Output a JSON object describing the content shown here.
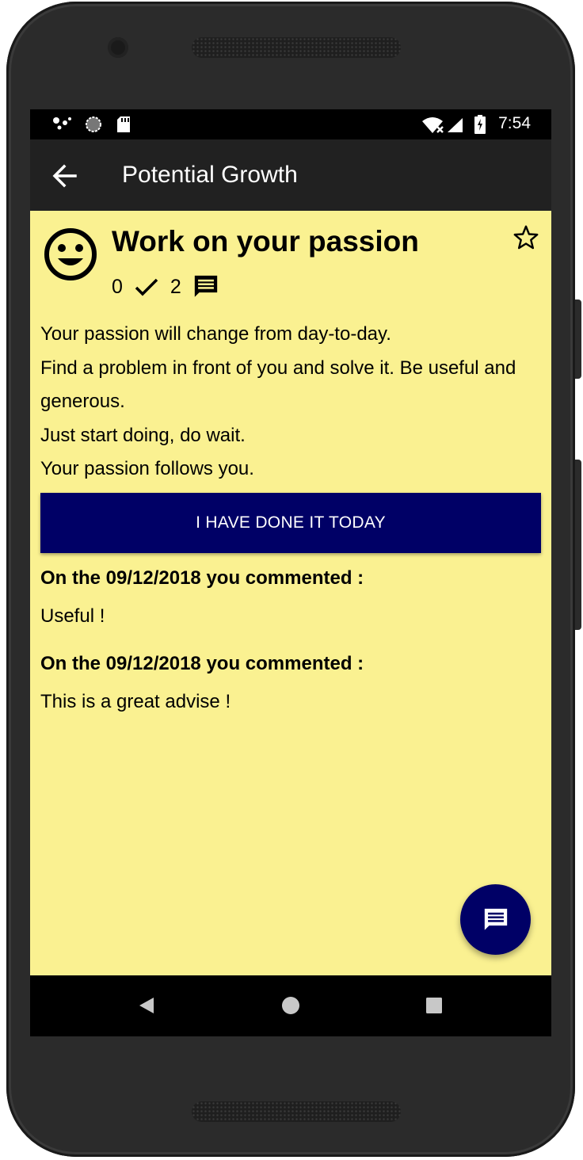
{
  "status_bar": {
    "time": "7:54"
  },
  "toolbar": {
    "title": "Potential Growth"
  },
  "advice": {
    "title": "Work on your passion",
    "done_count": "0",
    "comment_count": "2",
    "body": [
      "Your passion will change from day-to-day.",
      "Find a problem in front of you and solve it. Be useful and generous.",
      "Just start doing, do wait.",
      "Your passion follows you."
    ],
    "done_button_label": "I HAVE DONE IT TODAY"
  },
  "comments": [
    {
      "header": "On the 09/12/2018 you commented :",
      "text": "Useful !"
    },
    {
      "header": "On the 09/12/2018 you commented :",
      "text": "This is a great advise !"
    }
  ],
  "colors": {
    "background": "#faf191",
    "toolbar": "#212121",
    "accent": "#000066"
  },
  "icons": [
    "back-arrow-icon",
    "smiley-icon",
    "star-outline-icon",
    "checkmark-icon",
    "comment-icon",
    "nav-back-icon",
    "nav-home-icon",
    "nav-recents-icon"
  ]
}
